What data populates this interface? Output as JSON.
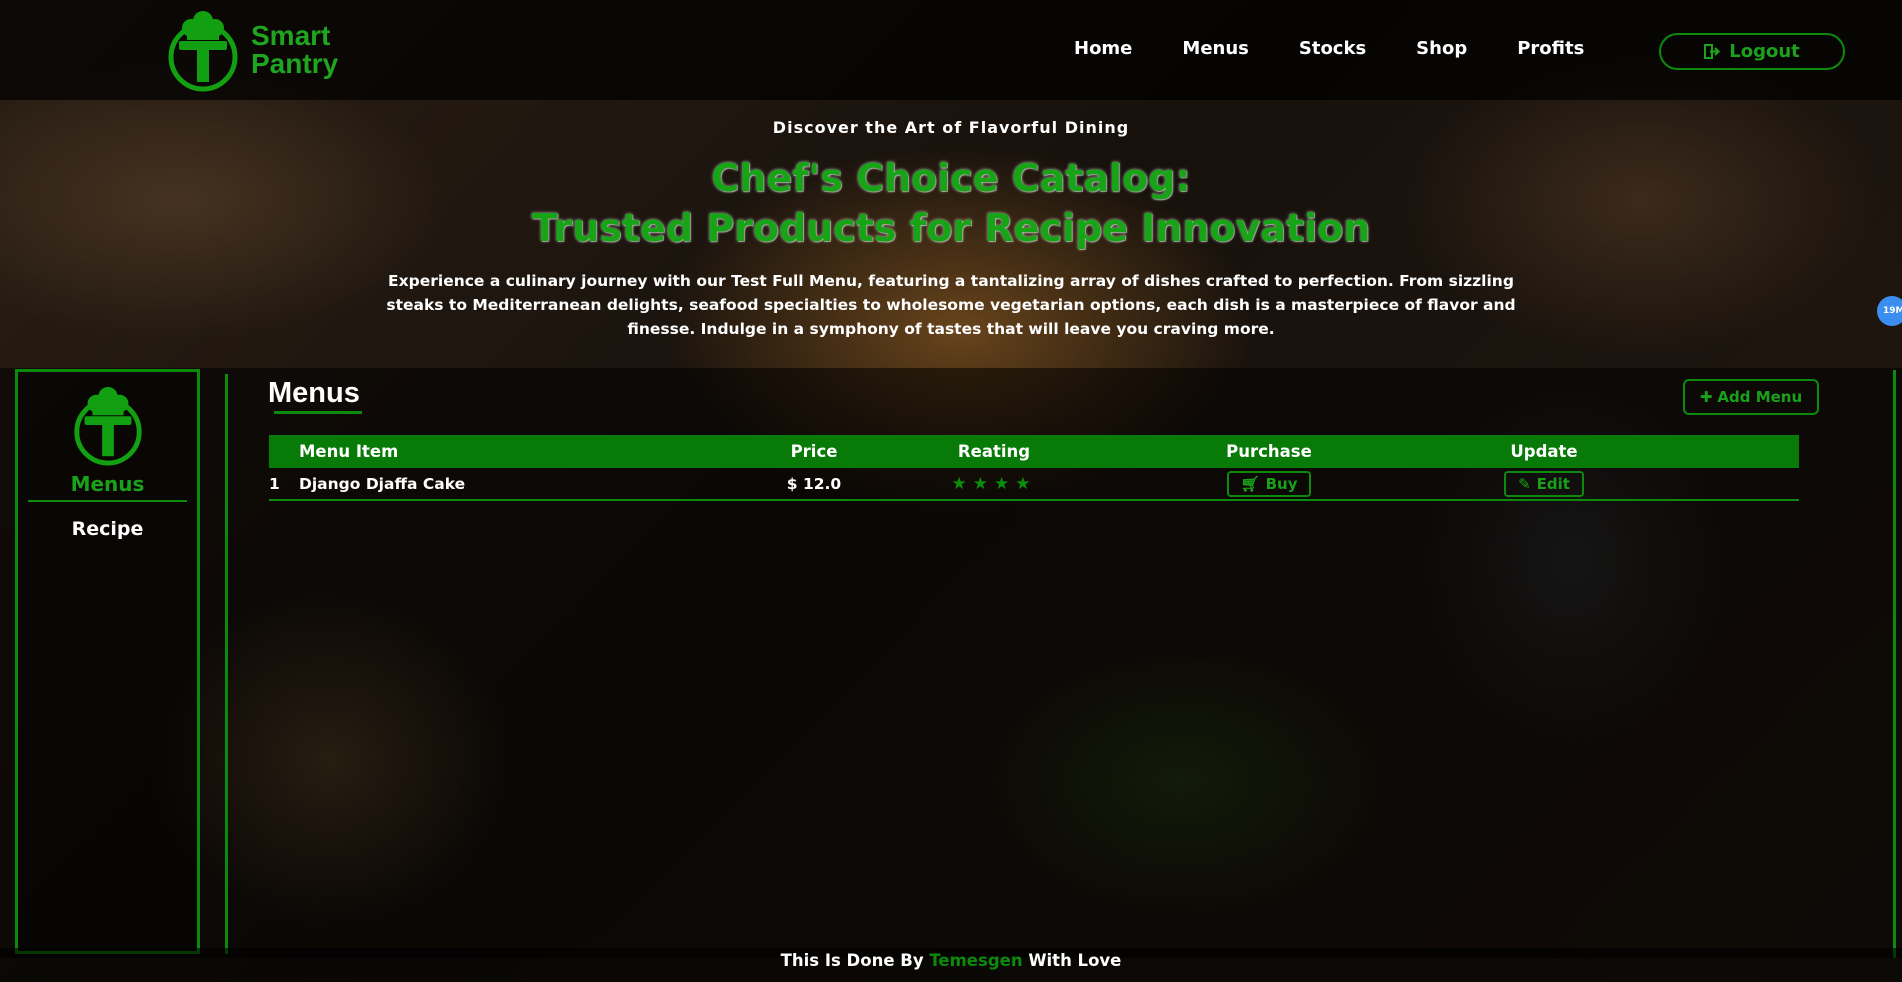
{
  "brand": {
    "line1": "Smart",
    "line2": "Pantry"
  },
  "nav": {
    "items": [
      "Home",
      "Menus",
      "Stocks",
      "Shop",
      "Profits"
    ],
    "logout": "Logout"
  },
  "hero": {
    "tagline": "Discover the Art of Flavorful Dining",
    "title_line1": "Chef's Choice Catalog:",
    "title_line2": "Trusted Products for Recipe Innovation",
    "description": "Experience a culinary journey with our Test Full Menu, featuring a tantalizing array of dishes crafted to perfection. From sizzling steaks to Mediterranean delights, seafood specialties to wholesome vegetarian options, each dish is a masterpiece of flavor and finesse. Indulge in a symphony of tastes that will leave you craving more."
  },
  "sidebar": {
    "items": [
      "Menus",
      "Recipe"
    ],
    "active": "Menus"
  },
  "content": {
    "title": "Menus",
    "add_button": "Add Menu",
    "columns": [
      "Menu Item",
      "Price",
      "Reating",
      "Purchase",
      "Update"
    ],
    "rows": [
      {
        "index": "1",
        "item": "Django Djaffa Cake",
        "price": "$ 12.0",
        "rating": 4,
        "rating_stars": "★★★★",
        "purchase": "Buy",
        "update": "Edit"
      }
    ]
  },
  "footer": {
    "prefix": "This Is Done By",
    "author": "Temesgen",
    "suffix": "With Love"
  },
  "badge": "19M",
  "colors": {
    "accent": "#0b8a0b",
    "accent_light": "#1aa11a",
    "header_bg": "#000000",
    "badge": "#3b8ef0"
  },
  "icons": [
    "chef-hat-logo-icon",
    "logout-icon",
    "plus-icon",
    "star-icon",
    "cart-icon",
    "edit-icon"
  ]
}
